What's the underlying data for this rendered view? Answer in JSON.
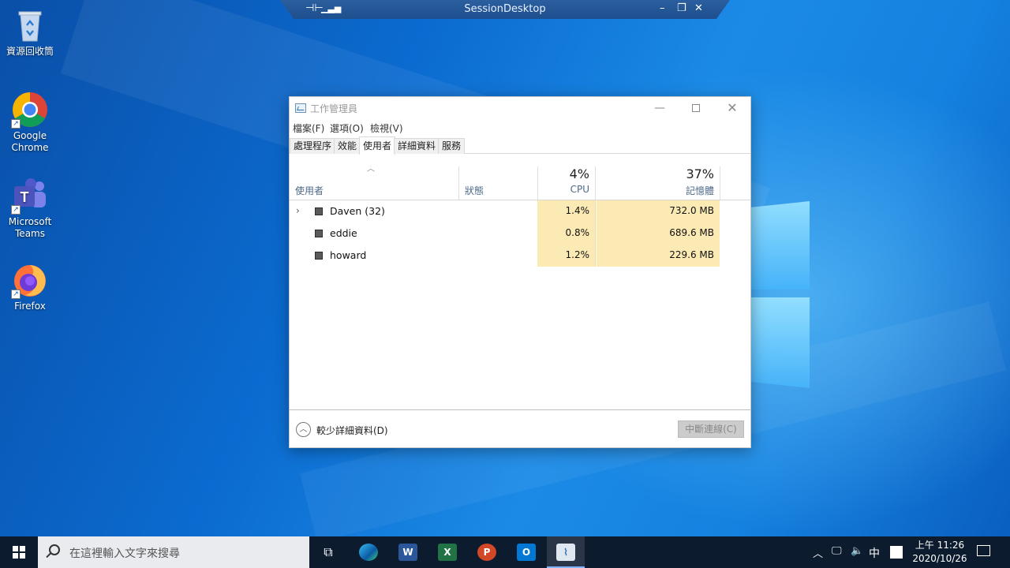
{
  "desktop": {
    "icons": [
      {
        "label": "資源回收筒"
      },
      {
        "label": "Google\nChrome"
      },
      {
        "label": "Microsoft\nTeams"
      },
      {
        "label": "Firefox"
      }
    ]
  },
  "session_bar": {
    "title": "SessionDesktop"
  },
  "task_manager": {
    "title": "工作管理員",
    "menu": [
      "檔案(F)",
      "選項(O)",
      "檢視(V)"
    ],
    "tabs": [
      "處理程序",
      "效能",
      "使用者",
      "詳細資料",
      "服務"
    ],
    "active_tab": "使用者",
    "columns": {
      "user": "使用者",
      "status": "狀態",
      "cpu_total": "4%",
      "cpu": "CPU",
      "mem_total": "37%",
      "mem": "記憶體"
    },
    "rows": [
      {
        "name": "Daven (32)",
        "cpu": "1.4%",
        "mem": "732.0 MB",
        "expandable": true
      },
      {
        "name": "eddie",
        "cpu": "0.8%",
        "mem": "689.6 MB",
        "expandable": false
      },
      {
        "name": "howard",
        "cpu": "1.2%",
        "mem": "229.6 MB",
        "expandable": false
      }
    ],
    "footer": {
      "fewer_details": "較少詳細資料(D)",
      "disconnect": "中斷連線(C)"
    }
  },
  "taskbar": {
    "search_placeholder": "在這裡輸入文字來搜尋",
    "apps": [
      "task-view",
      "edge",
      "word",
      "excel",
      "powerpoint",
      "outlook",
      "task-manager"
    ],
    "tray": {
      "ime": "中"
    },
    "clock": {
      "time": "上午 11:26",
      "date": "2020/10/26"
    }
  },
  "colors": {
    "cpu_heat": "#fbeab4",
    "taskbar": "#0d1b2e",
    "desktop": "#0b6bd0"
  }
}
